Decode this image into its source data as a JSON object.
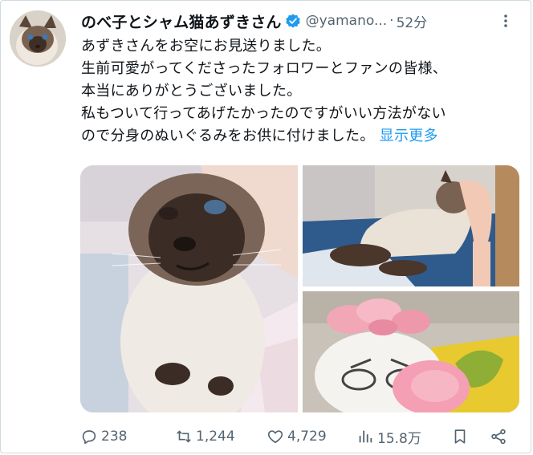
{
  "author": {
    "display_name": "のべ子とシャム猫あずきさん",
    "handle": "@yamano...",
    "separator": "·",
    "time": "52分",
    "verified": true
  },
  "tweet": {
    "lines": [
      "あずきさんをお空にお見送りました。",
      "生前可愛がってくださったフォロワーとファンの皆様、",
      "本当にありがとうございました。",
      "私もついて行ってあげたかったのですがいい方法がない",
      "ので分身のぬいぐるみをお供に付けました。"
    ],
    "show_more": "显示更多"
  },
  "media": {
    "images": [
      "siamese-cat-closeup-photo",
      "siamese-cat-lying-photo",
      "plush-toy-with-flowers-photo"
    ]
  },
  "actions": {
    "replies": "238",
    "reposts": "1,244",
    "likes": "4,729",
    "views": "15.8万"
  },
  "colors": {
    "text": "#0f1419",
    "secondary": "#536471",
    "link": "#1d9bf0",
    "verified": "#1d9bf0",
    "border": "#cfd9de"
  },
  "icons": {
    "more": "more-dots-icon",
    "reply": "reply-bubble-icon",
    "repost": "repost-arrows-icon",
    "like": "heart-icon",
    "views": "bar-chart-icon",
    "bookmark": "bookmark-icon",
    "share": "share-icon"
  }
}
